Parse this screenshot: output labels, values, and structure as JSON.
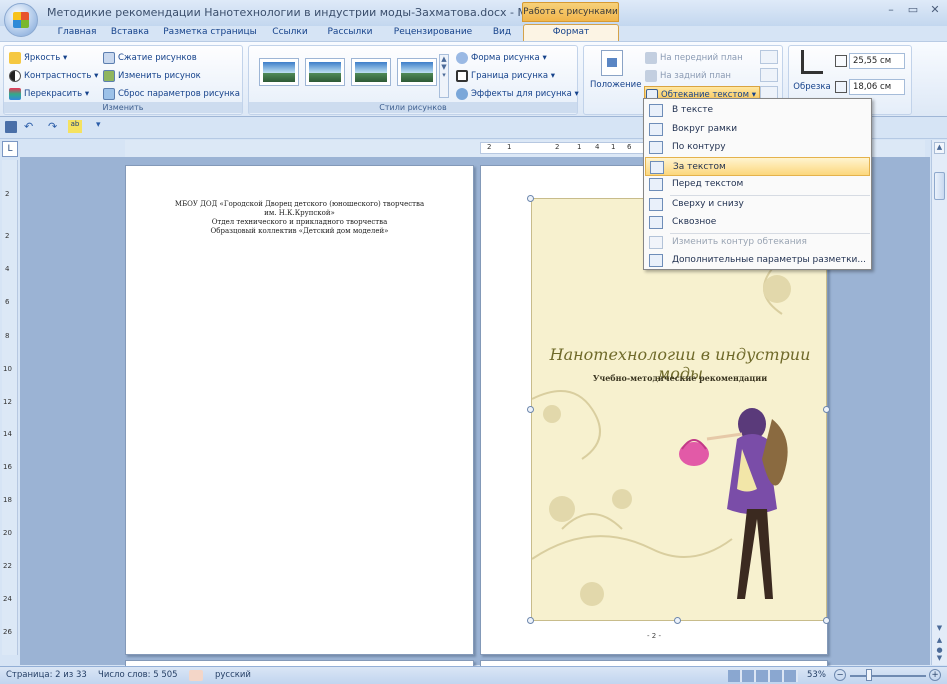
{
  "window": {
    "title": "Методикие рекомендации Нанотехнологии в индустрии моды-Захматова.docx - Microsoft ...",
    "context_tab_header": "Работа с рисунками",
    "controls": [
      "–",
      "▭",
      "✕"
    ]
  },
  "tabs": [
    {
      "label": "Главная"
    },
    {
      "label": "Вставка"
    },
    {
      "label": "Разметка страницы"
    },
    {
      "label": "Ссылки"
    },
    {
      "label": "Рассылки"
    },
    {
      "label": "Рецензирование"
    },
    {
      "label": "Вид"
    },
    {
      "label": "Формат",
      "active": true
    }
  ],
  "ribbon": {
    "adjust": {
      "brightness": "Яркость ▾",
      "contrast": "Контрастность ▾",
      "recolor": "Перекрасить ▾",
      "compress": "Сжатие рисунков",
      "change": "Изменить рисунок",
      "reset": "Сброс параметров рисунка",
      "label": "Изменить"
    },
    "styles": {
      "shape": "Форма рисунка ▾",
      "border": "Граница рисунка ▾",
      "effects": "Эффекты для рисунка ▾",
      "label": "Стили рисунков"
    },
    "arrange": {
      "position": "Положение",
      "front": "На передний план",
      "back": "На задний план",
      "wrap": "Обтекание текстом ▾"
    },
    "size": {
      "crop": "Обрезка",
      "height": "25,55 см",
      "width": "18,06 см"
    }
  },
  "wrap_menu": {
    "items": [
      {
        "label": "В тексте",
        "state": "normal"
      },
      {
        "label": "Вокруг рамки",
        "state": "normal"
      },
      {
        "label": "По контуру",
        "state": "normal"
      },
      {
        "label": "За текстом",
        "state": "highlighted"
      },
      {
        "label": "Перед текстом",
        "state": "normal"
      },
      {
        "label": "Сверху и снизу",
        "state": "normal"
      },
      {
        "label": "Сквозное",
        "state": "normal"
      },
      {
        "label": "Изменить контур обтекания",
        "state": "disabled"
      },
      {
        "label": "Дополнительные параметры разметки...",
        "state": "normal"
      }
    ]
  },
  "ruler": {
    "h_ticks": [
      "2",
      "1",
      "2",
      "1",
      "4",
      "1",
      "6"
    ],
    "v_ticks": [
      "2",
      "2",
      "4",
      "6",
      "8",
      "10",
      "12",
      "14",
      "16",
      "18",
      "20",
      "22",
      "24",
      "26"
    ],
    "corner": "L"
  },
  "page1": {
    "lines": [
      "МБОУ ДОД «Городской Дворец детского (юношеского) творчества",
      "им. Н.К.Крупской»",
      "Отдел технического и прикладного творчества",
      "Образцовый коллектив «Детский дом моделей»"
    ]
  },
  "page2": {
    "cover_title": "Нанотехнологии в индустрии моды",
    "cover_subtitle": "Учебно-методические рекомендации",
    "page_number": "- 2 -"
  },
  "status": {
    "page": "Страница: 2 из 33",
    "words": "Число слов: 5 505",
    "language": "русский",
    "zoom": "53%"
  }
}
